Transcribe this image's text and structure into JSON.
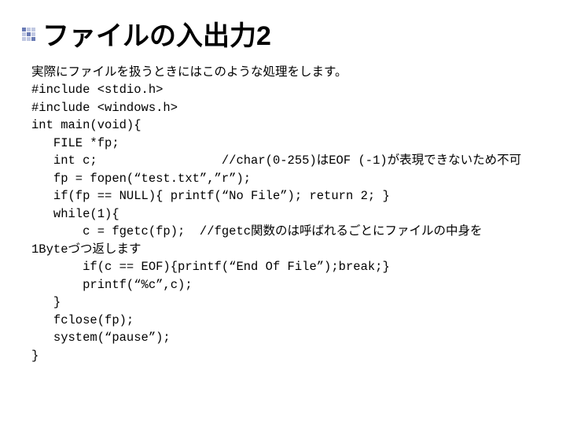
{
  "title": "ファイルの入出力2",
  "lines": {
    "l0": "実際にファイルを扱うときにはこのような処理をします。",
    "l1": "#include <stdio.h>",
    "l2": "#include <windows.h>",
    "l3": "int main(void){",
    "l4": "   FILE *fp;",
    "l5": "   int c;                 //char(0-255)はEOF (-1)が表現できないため不可",
    "l6": "   fp = fopen(“test.txt”,”r”);",
    "l7": "   if(fp == NULL){ printf(“No File”); return 2; }",
    "l8": "   while(1){",
    "l9": "       c = fgetc(fp);  //fgetc関数のは呼ばれるごとにファイルの中身を",
    "l10": "1Byteづつ返します",
    "l11": "       if(c == EOF){printf(“End Of File”);break;}",
    "l12": "       printf(“%c”,c);",
    "l13": "   }",
    "l14": "   fclose(fp);",
    "l15": "   system(“pause”);",
    "l16": "}"
  }
}
